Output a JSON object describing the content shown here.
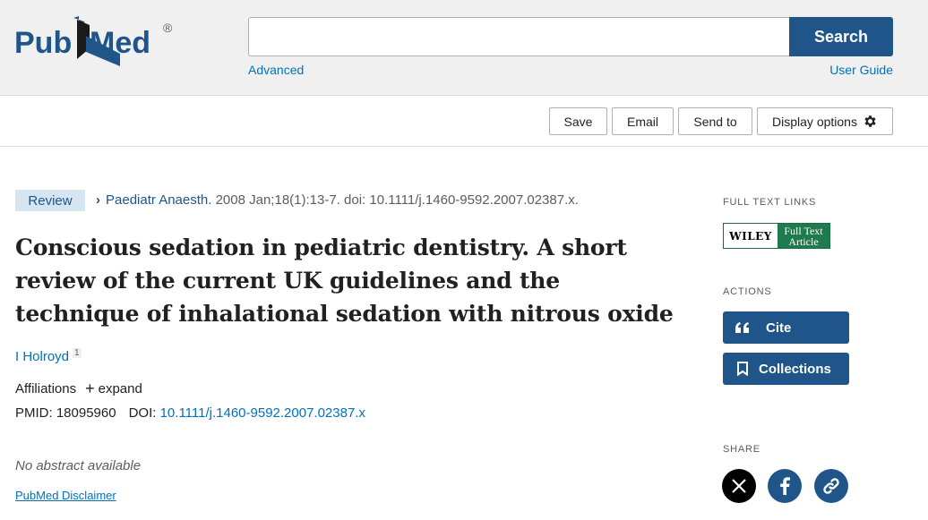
{
  "header": {
    "logo_text": "PubMed",
    "logo_mark": "®",
    "search_placeholder": "",
    "search_label": "Search",
    "advanced_label": "Advanced",
    "user_guide_label": "User Guide"
  },
  "toolbar": {
    "save_label": "Save",
    "email_label": "Email",
    "send_to_label": "Send to",
    "display_options_label": "Display options"
  },
  "article": {
    "type_badge": "Review",
    "journal": "Paediatr Anaesth.",
    "citation_rest": " 2008 Jan;18(1):13-7. doi: 10.1111/j.1460-9592.2007.02387.x.",
    "title": "Conscious sedation in pediatric dentistry. A short review of the current UK guidelines and the technique of inhalational sedation with nitrous oxide",
    "author": "I Holroyd",
    "author_affil_num": "1",
    "affiliations_label": "Affiliations",
    "expand_label": "expand",
    "pmid_label": "PMID: 18095960",
    "doi_label": "DOI:",
    "doi_value": "10.1111/j.1460-9592.2007.02387.x",
    "abstract_text": "No abstract available",
    "disclaimer": "PubMed Disclaimer"
  },
  "sidebar": {
    "full_text_heading": "FULL TEXT LINKS",
    "wiley_brand": "WILEY",
    "wiley_full_text": "Full Text",
    "wiley_article": "Article",
    "actions_heading": "ACTIONS",
    "cite_label": "Cite",
    "collections_label": "Collections",
    "share_heading": "SHARE"
  },
  "colors": {
    "brand_blue": "#20558a",
    "link_blue": "#0071bc",
    "header_bg": "#f0f0f0",
    "wiley_green": "#1f7a4d"
  }
}
